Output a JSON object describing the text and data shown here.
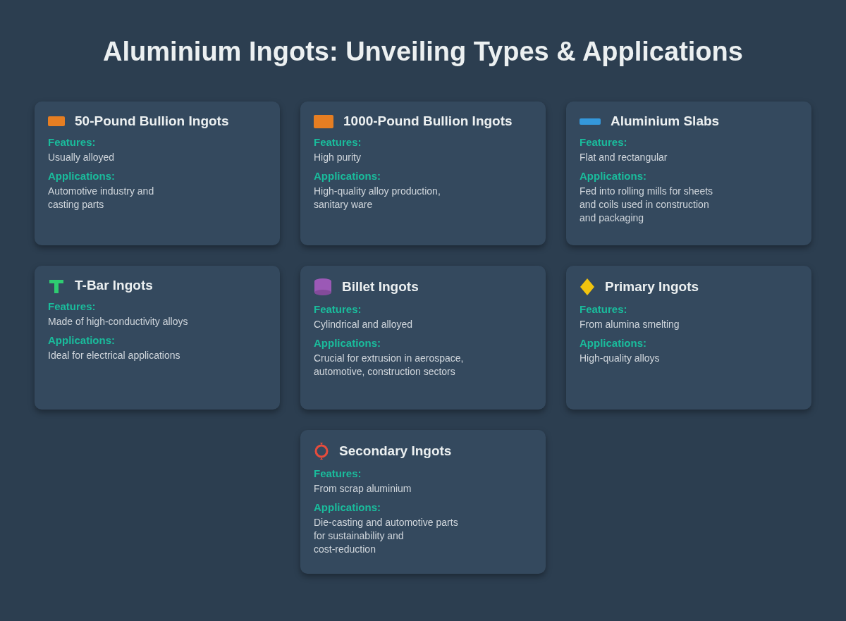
{
  "title": "Aluminium Ingots: Unveiling Types & Applications",
  "cards": [
    {
      "name": "50-Pound Bullion Ingots",
      "icon": {
        "kind": "small-bar",
        "color": "#e67e22"
      },
      "features_label": "Features:",
      "features": "Usually alloyed",
      "applications_label": "Applications:",
      "applications": "Automotive industry and\ncasting parts"
    },
    {
      "name": "1000-Pound Bullion Ingots",
      "icon": {
        "kind": "large-bar",
        "color": "#e67e22"
      },
      "features_label": "Features:",
      "features": "High purity",
      "applications_label": "Applications:",
      "applications": "High-quality alloy production,\nsanitary ware"
    },
    {
      "name": "Aluminium Slabs",
      "icon": {
        "kind": "slab",
        "color": "#3498db"
      },
      "features_label": "Features:",
      "features": "Flat and rectangular",
      "applications_label": "Applications:",
      "applications": "Fed into rolling mills for sheets\nand coils used in construction\nand packaging"
    },
    {
      "name": "T-Bar Ingots",
      "icon": {
        "kind": "tbar",
        "color": "#2ecc71"
      },
      "features_label": "Features:",
      "features": "Made of high-conductivity alloys",
      "applications_label": "Applications:",
      "applications": "Ideal for electrical applications"
    },
    {
      "name": "Billet Ingots",
      "icon": {
        "kind": "cylinder",
        "color": "#9b59b6"
      },
      "features_label": "Features:",
      "features": "Cylindrical and alloyed",
      "applications_label": "Applications:",
      "applications": "Crucial for extrusion in aerospace,\nautomotive, construction sectors"
    },
    {
      "name": "Primary Ingots",
      "icon": {
        "kind": "diamond",
        "color": "#f1c40f"
      },
      "features_label": "Features:",
      "features": "From alumina smelting",
      "applications_label": "Applications:",
      "applications": "High-quality alloys"
    },
    {
      "name": "Secondary Ingots",
      "icon": {
        "kind": "ring",
        "color": "#e74c3c"
      },
      "features_label": "Features:",
      "features": "From scrap aluminium",
      "applications_label": "Applications:",
      "applications": "Die-casting and automotive parts\nfor sustainability and\ncost-reduction"
    }
  ]
}
